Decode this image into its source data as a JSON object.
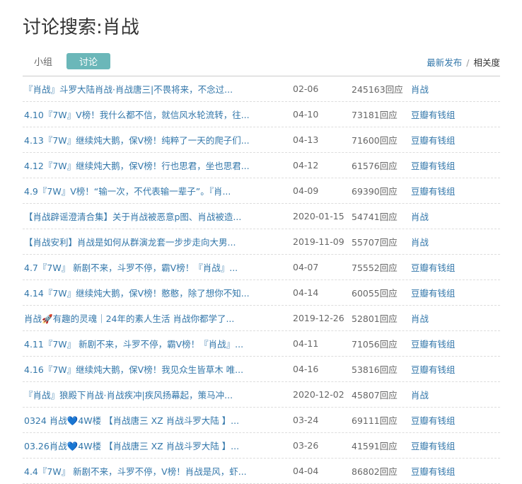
{
  "page": {
    "title": "讨论搜索:肖战"
  },
  "tabs": [
    {
      "label": "小组",
      "active": false
    },
    {
      "label": "讨论",
      "active": true
    }
  ],
  "sort": {
    "latest": "最新发布",
    "separator": "/",
    "relevance": "相关度"
  },
  "rows": [
    {
      "title": "『肖战』斗罗大陆肖战·肖战唐三|不畏将来，不念过...",
      "date": "02-06",
      "replies": "245163回应",
      "group": "肖战"
    },
    {
      "title": "4.10『7W』V榜！我什么都不信，就信风水轮流转，往...",
      "date": "04-10",
      "replies": "73181回应",
      "group": "豆瓣有钱组"
    },
    {
      "title": "4.13『7W』继续炖大鹅，保V榜！纯粹了一天的爬子们...",
      "date": "04-13",
      "replies": "71600回应",
      "group": "豆瓣有钱组"
    },
    {
      "title": "4.12『7W』继续炖大鹅，保V榜！行也思君，坐也思君...",
      "date": "04-12",
      "replies": "61576回应",
      "group": "豆瓣有钱组"
    },
    {
      "title": "4.9『7W』V榜！“输一次，不代表输一辈子”。『肖...",
      "date": "04-09",
      "replies": "69390回应",
      "group": "豆瓣有钱组"
    },
    {
      "title": "【肖战辟谣澄清合集】关于肖战被恶意p图、肖战被造...",
      "date": "2020-01-15",
      "replies": "54741回应",
      "group": "肖战"
    },
    {
      "title": "【肖战安利】肖战是如何从群演龙套一步步走向大男...",
      "date": "2019-11-09",
      "replies": "55707回应",
      "group": "肖战"
    },
    {
      "title": "4.7『7W』 新剧不来，斗罗不停，霸V榜！『肖战』...",
      "date": "04-07",
      "replies": "75552回应",
      "group": "豆瓣有钱组"
    },
    {
      "title": "4.14『7W』继续炖大鹅，保V榜！憨憨，除了想你不知...",
      "date": "04-14",
      "replies": "60055回应",
      "group": "豆瓣有钱组"
    },
    {
      "title": "肖战🚀有趣的灵魂｜24年的素人生活 肖战你都学了...",
      "date": "2019-12-26",
      "replies": "52801回应",
      "group": "肖战"
    },
    {
      "title": "4.11『7W』 新剧不来，斗罗不停，霸V榜！『肖战』...",
      "date": "04-11",
      "replies": "71056回应",
      "group": "豆瓣有钱组"
    },
    {
      "title": "4.16『7W』继续炖大鹅，保V榜！我见众生皆草木 唯...",
      "date": "04-16",
      "replies": "53816回应",
      "group": "豆瓣有钱组"
    },
    {
      "title": "『肖战』狼殿下肖战·肖战疾冲|疾风扬幕起，策马冲...",
      "date": "2020-12-02",
      "replies": "45807回应",
      "group": "肖战"
    },
    {
      "title": "0324 肖战💙4W楼 【肖战唐三 XZ 肖战斗罗大陆 】...",
      "date": "03-24",
      "replies": "69111回应",
      "group": "豆瓣有钱组"
    },
    {
      "title": "03.26肖战💙4W楼 【肖战唐三 XZ 肖战斗罗大陆 】...",
      "date": "03-26",
      "replies": "41591回应",
      "group": "豆瓣有钱组"
    },
    {
      "title": "4.4『7W』 新剧不来，斗罗不停，V榜！肖战是风，虾...",
      "date": "04-04",
      "replies": "86802回应",
      "group": "豆瓣有钱组"
    }
  ]
}
